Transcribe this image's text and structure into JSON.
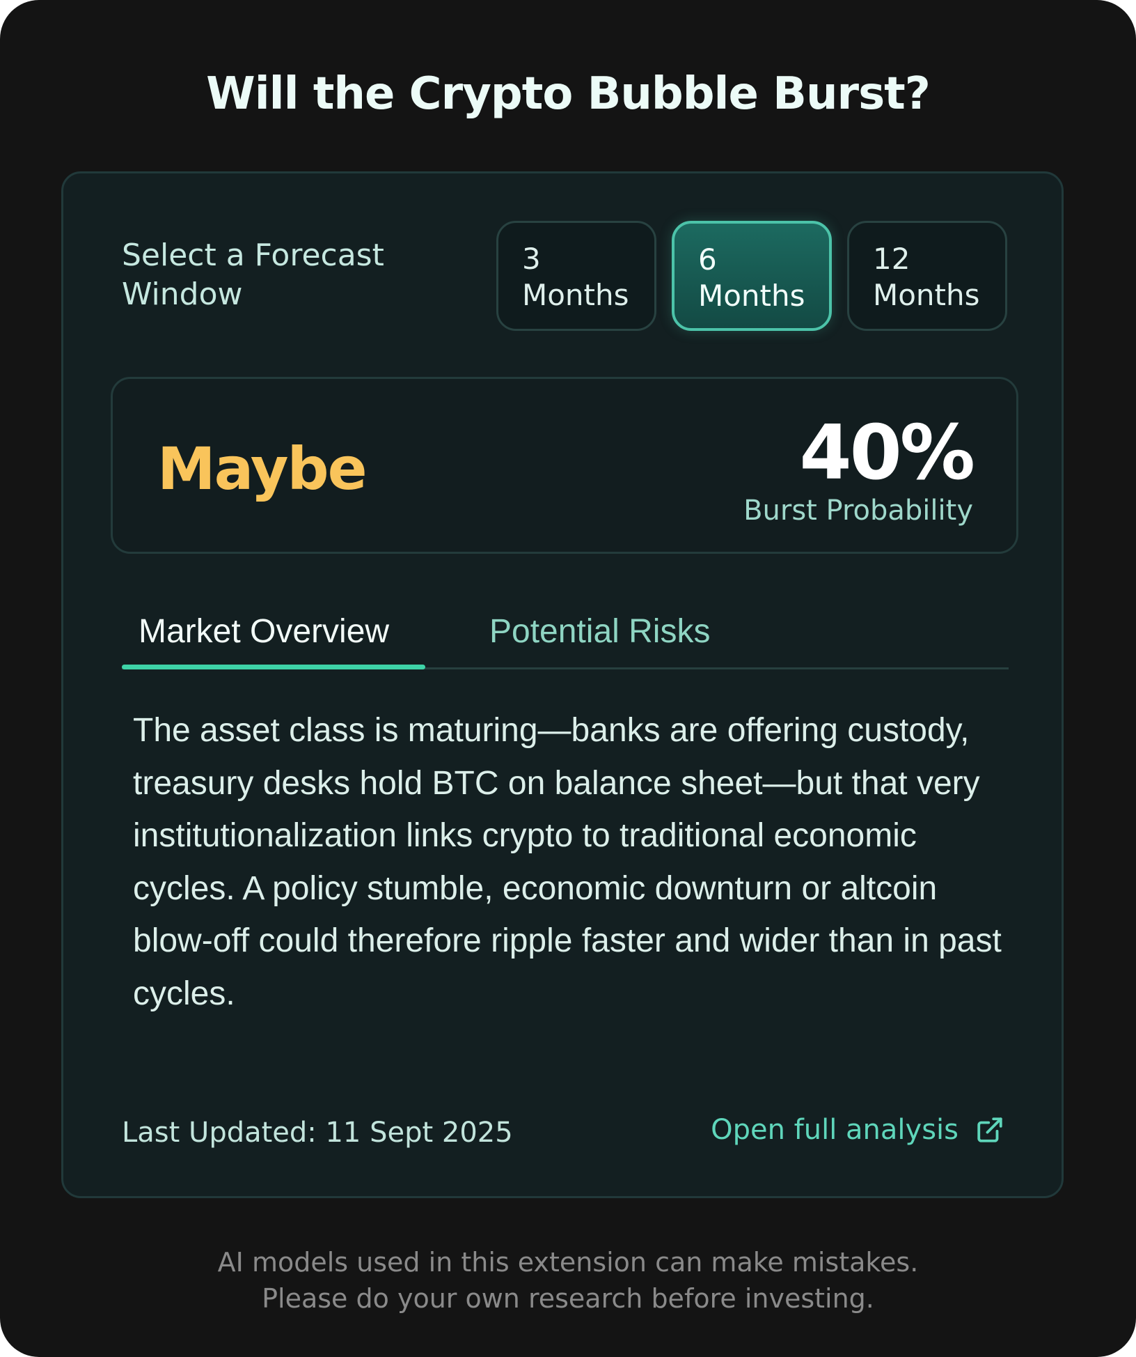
{
  "title": "Will the Crypto Bubble Burst?",
  "forecast": {
    "label": "Select a Forecast Window",
    "options": [
      {
        "num": "3",
        "unit": "Months",
        "selected": false
      },
      {
        "num": "6",
        "unit": "Months",
        "selected": true
      },
      {
        "num": "12",
        "unit": "Months",
        "selected": false
      }
    ]
  },
  "result": {
    "verdict": "Maybe",
    "probability": "40%",
    "probability_label": "Burst Probability"
  },
  "tabs": [
    {
      "label": "Market Overview",
      "active": true
    },
    {
      "label": "Potential Risks",
      "active": false
    }
  ],
  "content": {
    "text": "The asset class is maturing—banks are offering custody, treasury desks hold BTC on balance sheet—but that very institutionalization links crypto to traditional economic cycles. A policy stumble, economic downturn or altcoin blow-off could therefore ripple faster and wider than in past cycles."
  },
  "footer": {
    "updated": "Last Updated: 11 Sept 2025",
    "link_label": "Open full analysis",
    "link_icon": "external-link-icon"
  },
  "disclaimer": {
    "line1": "AI models used in this extension can make mistakes.",
    "line2": "Please do your own research before investing."
  },
  "colors": {
    "verdict": "#f9c45b",
    "accent": "#3ed3a7",
    "background": "#141414",
    "card": "#131f21"
  }
}
